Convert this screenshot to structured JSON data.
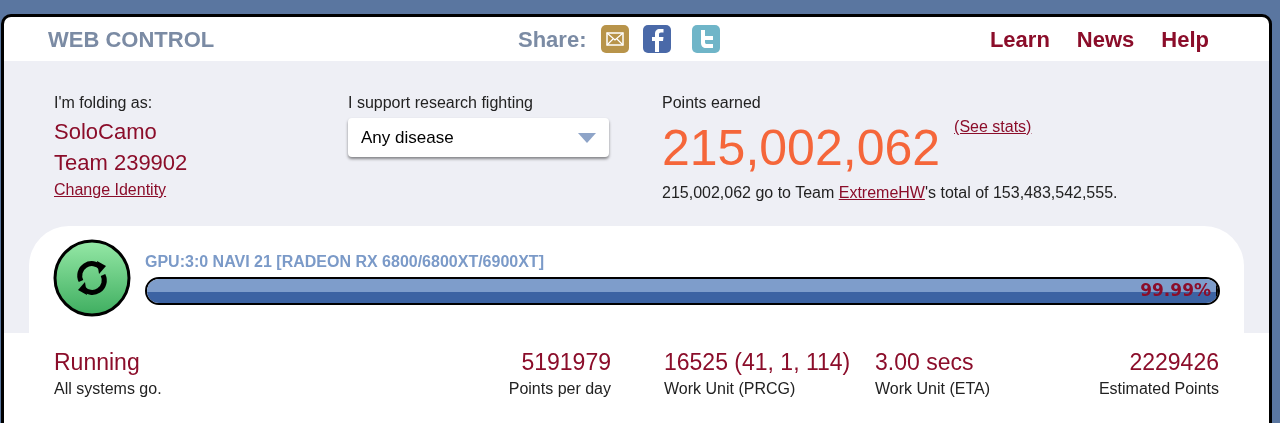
{
  "header": {
    "title": "WEB CONTROL",
    "share_label": "Share:",
    "nav": [
      "Learn",
      "News",
      "Help"
    ]
  },
  "identity": {
    "label": "I'm folding as:",
    "user": "SoloCamo",
    "team": "Team 239902",
    "change_link": "Change Identity"
  },
  "cause": {
    "label": "I support research fighting",
    "value": "Any disease"
  },
  "points": {
    "label": "Points earned",
    "value": "215,002,062",
    "stats_link": "(See stats)",
    "summary_before": "215,002,062 go to Team ",
    "team_link": "ExtremeHW",
    "summary_after": "'s total of 153,483,542,555."
  },
  "slot": {
    "name": "GPU:3:0 NAVI 21 [RADEON RX 6800/6800XT/6900XT]",
    "level": 0.9999,
    "percent": "99.99%"
  },
  "status": {
    "title": "Running",
    "subtitle": "All systems go."
  },
  "stats": [
    {
      "value": "5191979",
      "label": "Points per day"
    },
    {
      "value": "16525 (41, 1, 114)",
      "label": "Work Unit (PRCG)"
    },
    {
      "value": "3.00 secs",
      "label": "Work Unit (ETA)"
    },
    {
      "value": "2229426",
      "label": "Estimated Points"
    }
  ]
}
